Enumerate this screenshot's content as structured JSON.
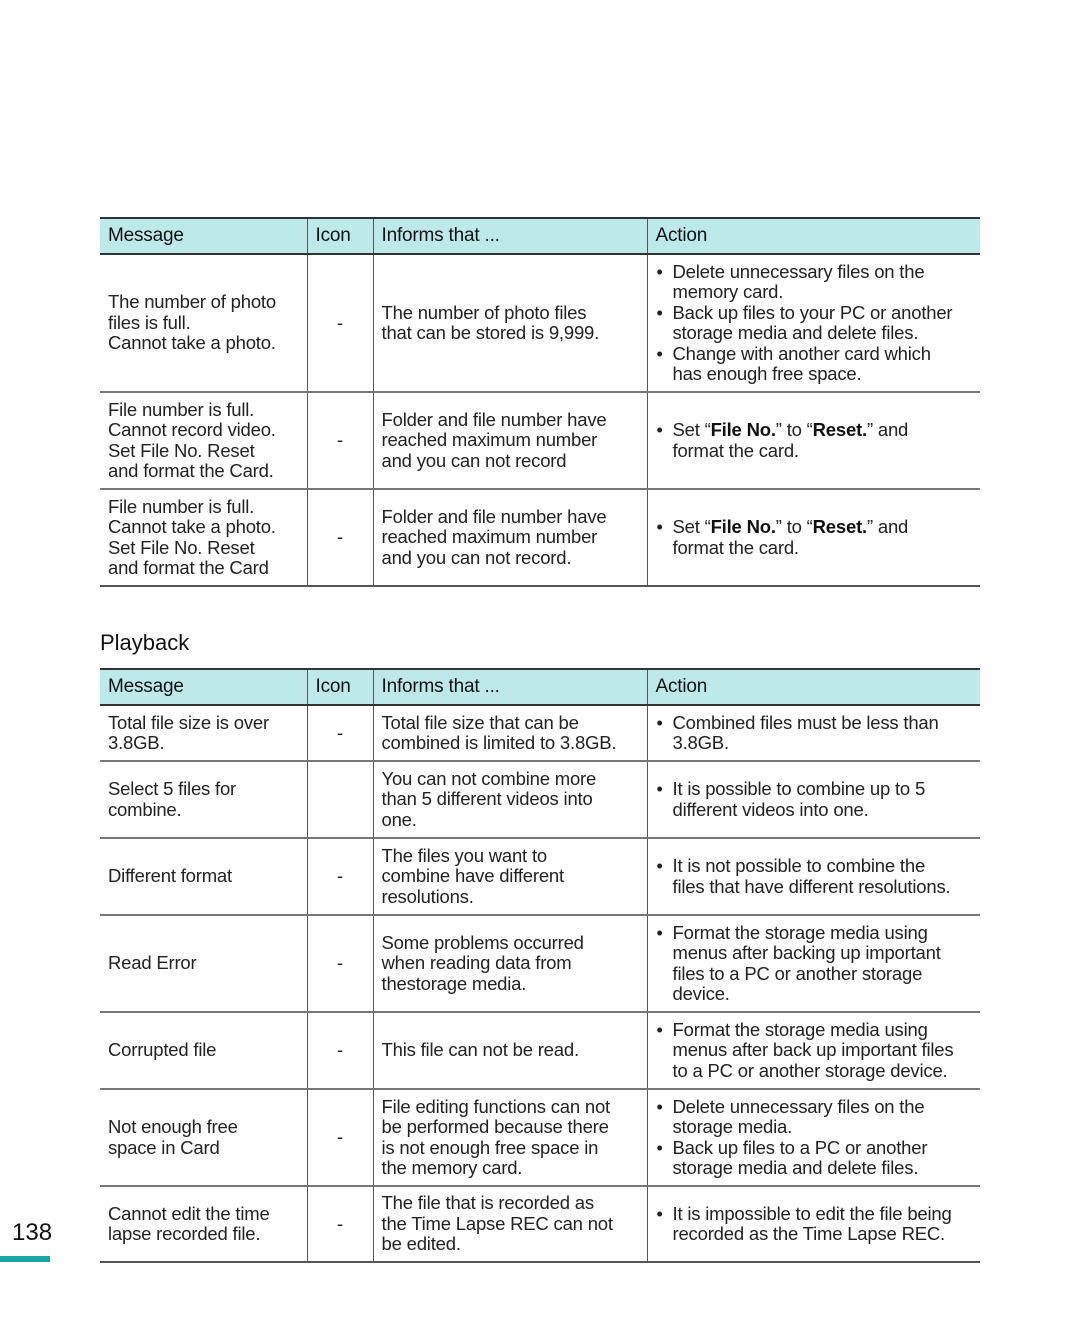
{
  "columns": [
    "Message",
    "Icon",
    "Informs that ...",
    "Action"
  ],
  "table1": {
    "rows": [
      {
        "message": [
          "The number of photo",
          "files is full.",
          "Cannot  take a photo."
        ],
        "icon": "-",
        "informs": [
          "The number of photo files",
          "that can be stored is 9,999."
        ],
        "actions": [
          [
            "Delete unnecessary files on the",
            "memory card."
          ],
          [
            "Back up files to your PC or another",
            "storage media and delete files."
          ],
          [
            "Change with another card which",
            "has enough free space."
          ]
        ]
      },
      {
        "message": [
          "File number is full.",
          "Cannot record video.",
          "Set File No. Reset",
          "and format the Card."
        ],
        "icon": "-",
        "informs": [
          "Folder and file number have",
          "reached maximum number",
          "and you can not record"
        ],
        "action_rich": {
          "pre": "Set “",
          "kw1": "File No.",
          "mid": "” to “",
          "kw2": "Reset.",
          "post": "” and",
          "line2": "format the card."
        }
      },
      {
        "message": [
          "File number is full.",
          "Cannot take a photo.",
          "Set File No. Reset",
          "and format the Card"
        ],
        "icon": "-",
        "informs": [
          "Folder and file number have",
          "reached maximum number",
          "and you can not record."
        ],
        "action_rich": {
          "pre": "Set “",
          "kw1": "File No.",
          "mid": "” to “",
          "kw2": "Reset.",
          "post": "” and",
          "line2": "format the card."
        }
      }
    ]
  },
  "section_title": "Playback",
  "table2": {
    "rows": [
      {
        "message": [
          "Total file size is over",
          "3.8GB."
        ],
        "icon": "-",
        "informs": [
          "Total file size that can be",
          "combined is limited to 3.8GB."
        ],
        "actions": [
          [
            "Combined files must be less than",
            "3.8GB."
          ]
        ]
      },
      {
        "message": [
          "Select 5 files for",
          "combine."
        ],
        "icon": "",
        "informs": [
          "You can not combine more",
          "than 5 different videos into",
          "one."
        ],
        "actions": [
          [
            "It is possible to combine up to 5",
            "different videos into one."
          ]
        ]
      },
      {
        "message": [
          "Different format"
        ],
        "icon": "-",
        "informs": [
          "The files you want to",
          "combine have different",
          "resolutions."
        ],
        "actions": [
          [
            "It is not possible to combine the",
            "files that have different resolutions."
          ]
        ]
      },
      {
        "message": [
          "Read Error"
        ],
        "icon": "-",
        "informs": [
          "Some problems occurred",
          "when reading data from",
          "thestorage media."
        ],
        "actions": [
          [
            "Format the storage media using",
            "menus after backing up  important",
            "files to a PC or another storage",
            "device."
          ]
        ]
      },
      {
        "message": [
          "Corrupted file"
        ],
        "icon": "-",
        "informs": [
          "This file can not be read."
        ],
        "actions": [
          [
            "Format the storage media using",
            "menus after back up important files",
            "to a PC or another storage device."
          ]
        ]
      },
      {
        "message": [
          "Not enough free",
          "space in Card"
        ],
        "icon": "-",
        "informs": [
          "File editing functions can not",
          "be performed because there",
          "is not enough free space in",
          "the memory card."
        ],
        "actions": [
          [
            "Delete unnecessary files on the",
            "storage media."
          ],
          [
            "Back up files to a PC or another",
            "storage media and delete files."
          ]
        ]
      },
      {
        "message": [
          "Cannot edit the time",
          "lapse recorded file."
        ],
        "icon": "-",
        "informs": [
          "The file that is recorded as",
          "the Time Lapse REC can not",
          "be edited."
        ],
        "actions": [
          [
            "It is impossible to edit the file being",
            "recorded as the Time Lapse REC."
          ]
        ]
      }
    ]
  },
  "page_number": "138",
  "colors": {
    "header_bg": "#bde9ea",
    "accent_bar": "#1aa5a5"
  }
}
